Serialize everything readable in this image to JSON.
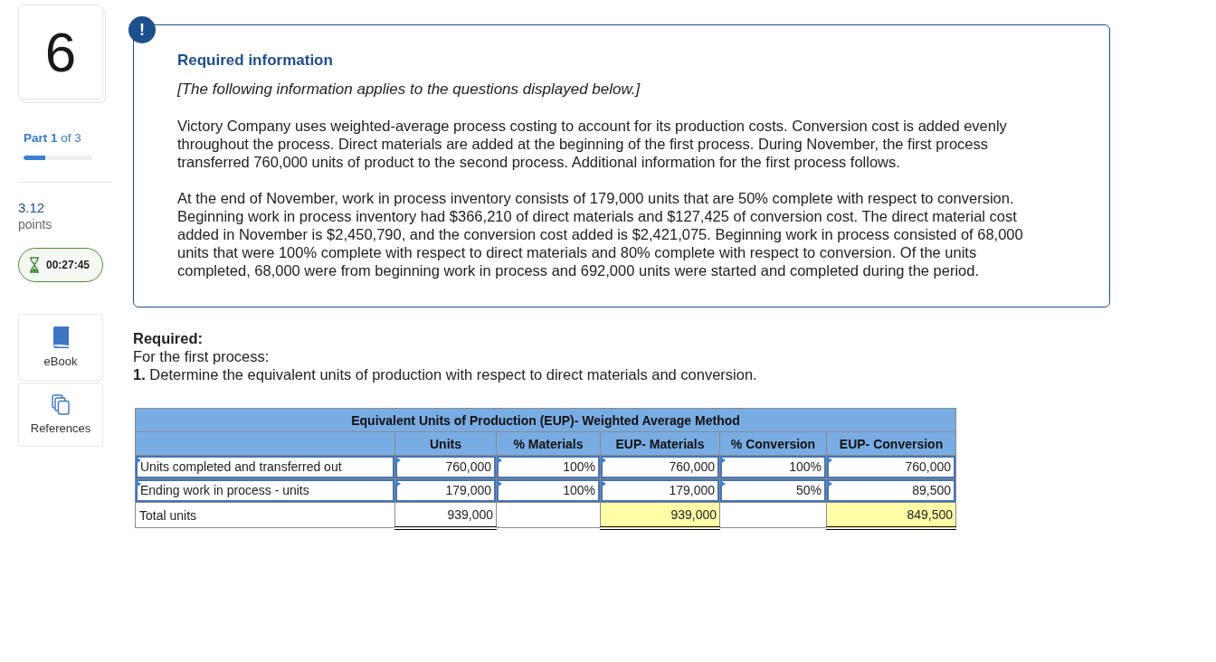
{
  "question": {
    "number": "6",
    "part": "**Part 1** of 3",
    "progress": {
      "level": 0.32
    },
    "points": "3.12",
    "points_label": "points",
    "timer": "00:27:45"
  },
  "resources": [
    {
      "kind": "ebook",
      "label": "eBook"
    },
    {
      "kind": "references",
      "label": "References"
    }
  ],
  "info": {
    "badge": "!",
    "title": "Required information",
    "note": "[The following information applies to the questions displayed below.]",
    "paragraphs": [
      "Victory Company uses weighted-average process costing to account for its production costs. Conversion cost is added evenly throughout the process. Direct materials are added at the beginning of the first process. During November, the first process transferred 760,000 units of product to the second process. Additional information for the first process follows.",
      "At the end of November, work in process inventory consists of 179,000 units that are 50% complete with respect to conversion. Beginning work in process inventory had $366,210 of direct materials and $127,425 of conversion cost. The direct material cost added in November is $2,450,790, and the conversion cost added is $2,421,075. Beginning work in process consisted of 68,000 units that were 100% complete with respect to direct materials and 80% complete with respect to conversion. Of the units completed, 68,000 were from beginning work in process and 692,000 units were started and completed during the period."
    ]
  },
  "required": {
    "heading": "Required:",
    "subtitle": "For the first process:",
    "task": "**1.** Determine the equivalent units of production with respect to direct materials and conversion."
  },
  "table": {
    "title": "Equivalent Units of Production (EUP)- Weighted Average Method",
    "columns": [
      "Units",
      "% Materials",
      "EUP- Materials",
      "% Conversion",
      "EUP- Conversion"
    ],
    "rows": [
      {
        "label": {
          "kind": "input",
          "text": "Units completed and transferred out"
        },
        "cells": [
          {
            "kind": "input",
            "value": "760,000"
          },
          {
            "kind": "input",
            "value": "100%"
          },
          {
            "kind": "input",
            "value": "760,000"
          },
          {
            "kind": "input",
            "value": "100%"
          },
          {
            "kind": "input",
            "value": "760,000"
          }
        ]
      },
      {
        "label": {
          "kind": "input",
          "text": "Ending work in process - units"
        },
        "cells": [
          {
            "kind": "input",
            "value": "179,000"
          },
          {
            "kind": "input",
            "value": "100%"
          },
          {
            "kind": "input",
            "value": "179,000"
          },
          {
            "kind": "input",
            "value": "50%"
          },
          {
            "kind": "input",
            "value": "89,500"
          }
        ]
      },
      {
        "label": {
          "kind": "text",
          "text": "Total units"
        },
        "cells": [
          {
            "kind": "total",
            "value": "939,000",
            "highlighted": false
          },
          {
            "kind": "blank"
          },
          {
            "kind": "total",
            "value": "939,000",
            "highlighted": true
          },
          {
            "kind": "blank"
          },
          {
            "kind": "total",
            "value": "849,500",
            "highlighted": true
          }
        ]
      }
    ]
  }
}
